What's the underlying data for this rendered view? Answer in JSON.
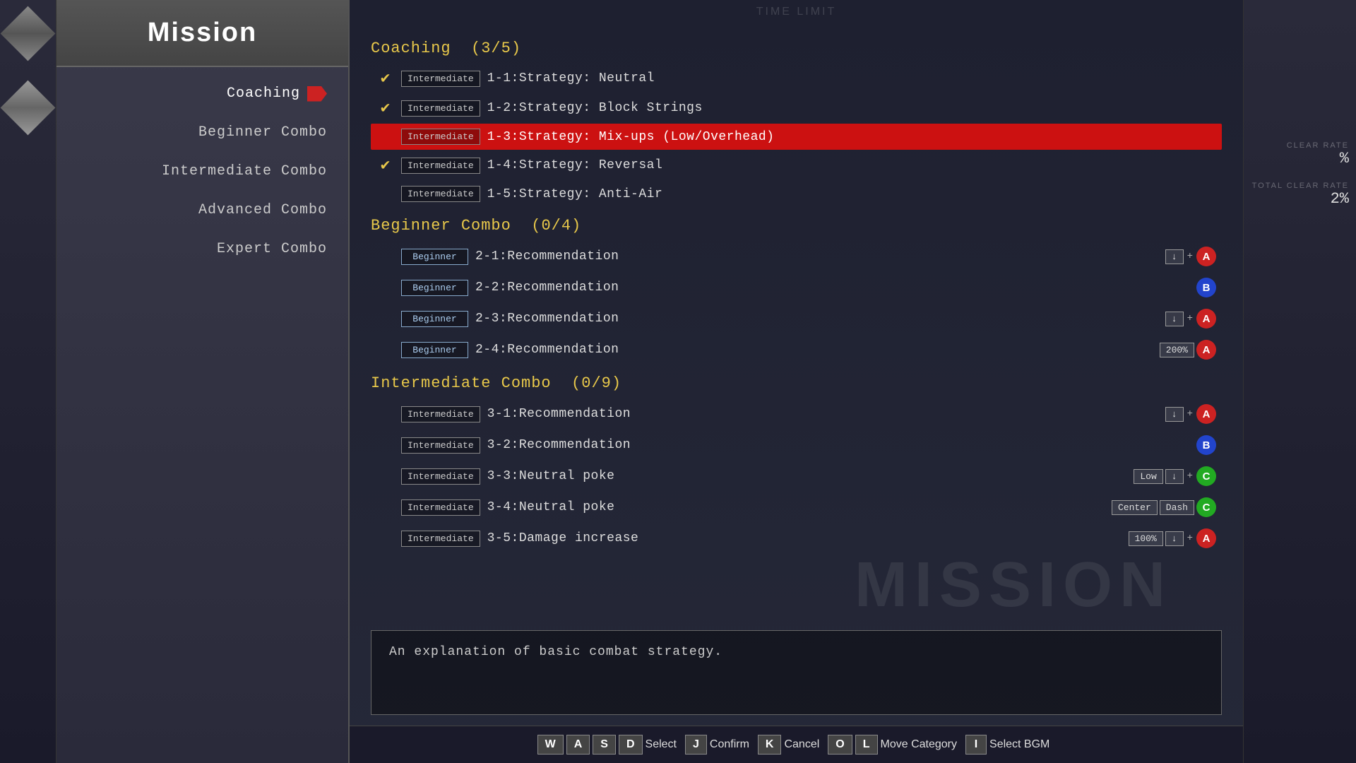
{
  "sidebar": {
    "title": "Mission",
    "items": [
      {
        "id": "coaching",
        "label": "Coaching",
        "active": true
      },
      {
        "id": "beginner-combo",
        "label": "Beginner Combo",
        "active": false
      },
      {
        "id": "intermediate-combo",
        "label": "Intermediate Combo",
        "active": false
      },
      {
        "id": "advanced-combo",
        "label": "Advanced Combo",
        "active": false
      },
      {
        "id": "expert-combo",
        "label": "Expert Combo",
        "active": false
      }
    ]
  },
  "header": {
    "time_limit_label": "TIME LIMIT"
  },
  "categories": [
    {
      "id": "coaching",
      "name": "Coaching",
      "progress": "(3/5)",
      "missions": [
        {
          "id": "1-1",
          "completed": true,
          "difficulty": "Intermediate",
          "name": "1-1:Strategy: Neutral",
          "selected": false,
          "buttons": []
        },
        {
          "id": "1-2",
          "completed": true,
          "difficulty": "Intermediate",
          "name": "1-2:Strategy: Block Strings",
          "selected": false,
          "buttons": []
        },
        {
          "id": "1-3",
          "completed": false,
          "difficulty": "Intermediate",
          "name": "1-3:Strategy: Mix-ups (Low/Overhead)",
          "selected": true,
          "buttons": []
        },
        {
          "id": "1-4",
          "completed": true,
          "difficulty": "Intermediate",
          "name": "1-4:Strategy: Reversal",
          "selected": false,
          "buttons": []
        },
        {
          "id": "1-5",
          "completed": false,
          "difficulty": "Intermediate",
          "name": "1-5:Strategy: Anti-Air",
          "selected": false,
          "buttons": []
        }
      ]
    },
    {
      "id": "beginner-combo",
      "name": "Beginner Combo",
      "progress": "(0/4)",
      "missions": [
        {
          "id": "2-1",
          "completed": false,
          "difficulty": "Beginner",
          "name": "2-1:Recommendation",
          "selected": false,
          "has_buttons": true,
          "button_type": "down_plus_A"
        },
        {
          "id": "2-2",
          "completed": false,
          "difficulty": "Beginner",
          "name": "2-2:Recommendation",
          "selected": false,
          "has_buttons": true,
          "button_type": "B"
        },
        {
          "id": "2-3",
          "completed": false,
          "difficulty": "Beginner",
          "name": "2-3:Recommendation",
          "selected": false,
          "has_buttons": true,
          "button_type": "down_plus_A"
        },
        {
          "id": "2-4",
          "completed": false,
          "difficulty": "Beginner",
          "name": "2-4:Recommendation",
          "selected": false,
          "has_buttons": true,
          "button_type": "200_A"
        }
      ]
    },
    {
      "id": "intermediate-combo",
      "name": "Intermediate Combo",
      "progress": "(0/9)",
      "missions": [
        {
          "id": "3-1",
          "completed": false,
          "difficulty": "Intermediate",
          "name": "3-1:Recommendation",
          "selected": false,
          "has_buttons": true,
          "button_type": "down_plus_A"
        },
        {
          "id": "3-2",
          "completed": false,
          "difficulty": "Intermediate",
          "name": "3-2:Recommendation",
          "selected": false,
          "has_buttons": true,
          "button_type": "B"
        },
        {
          "id": "3-3",
          "completed": false,
          "difficulty": "Intermediate",
          "name": "3-3:Neutral poke",
          "selected": false,
          "has_buttons": true,
          "button_type": "Low_down_plus_C"
        },
        {
          "id": "3-4",
          "completed": false,
          "difficulty": "Intermediate",
          "name": "3-4:Neutral poke",
          "selected": false,
          "has_buttons": true,
          "button_type": "Center_Dash_C"
        },
        {
          "id": "3-5",
          "completed": false,
          "difficulty": "Intermediate",
          "name": "3-5:Damage increase",
          "selected": false,
          "has_buttons": true,
          "button_type": "100_down_A"
        }
      ]
    }
  ],
  "description": {
    "text": "An explanation of basic combat strategy."
  },
  "stats": {
    "clear_rate_label": "CLEAR RATE",
    "clear_rate_value": "%",
    "total_clear_label": "TOTAL CLEAR RATE",
    "total_clear_value": "2%"
  },
  "bg_text": "MISSION",
  "controls": [
    {
      "key": "W",
      "label": ""
    },
    {
      "key": "A",
      "label": ""
    },
    {
      "key": "S",
      "label": ""
    },
    {
      "key": "D",
      "label": "Select"
    },
    {
      "key": "J",
      "label": "Confirm"
    },
    {
      "key": "K",
      "label": "Cancel"
    },
    {
      "key": "O",
      "label": ""
    },
    {
      "key": "L",
      "label": "Move Category"
    },
    {
      "key": "I",
      "label": "Select BGM"
    }
  ]
}
